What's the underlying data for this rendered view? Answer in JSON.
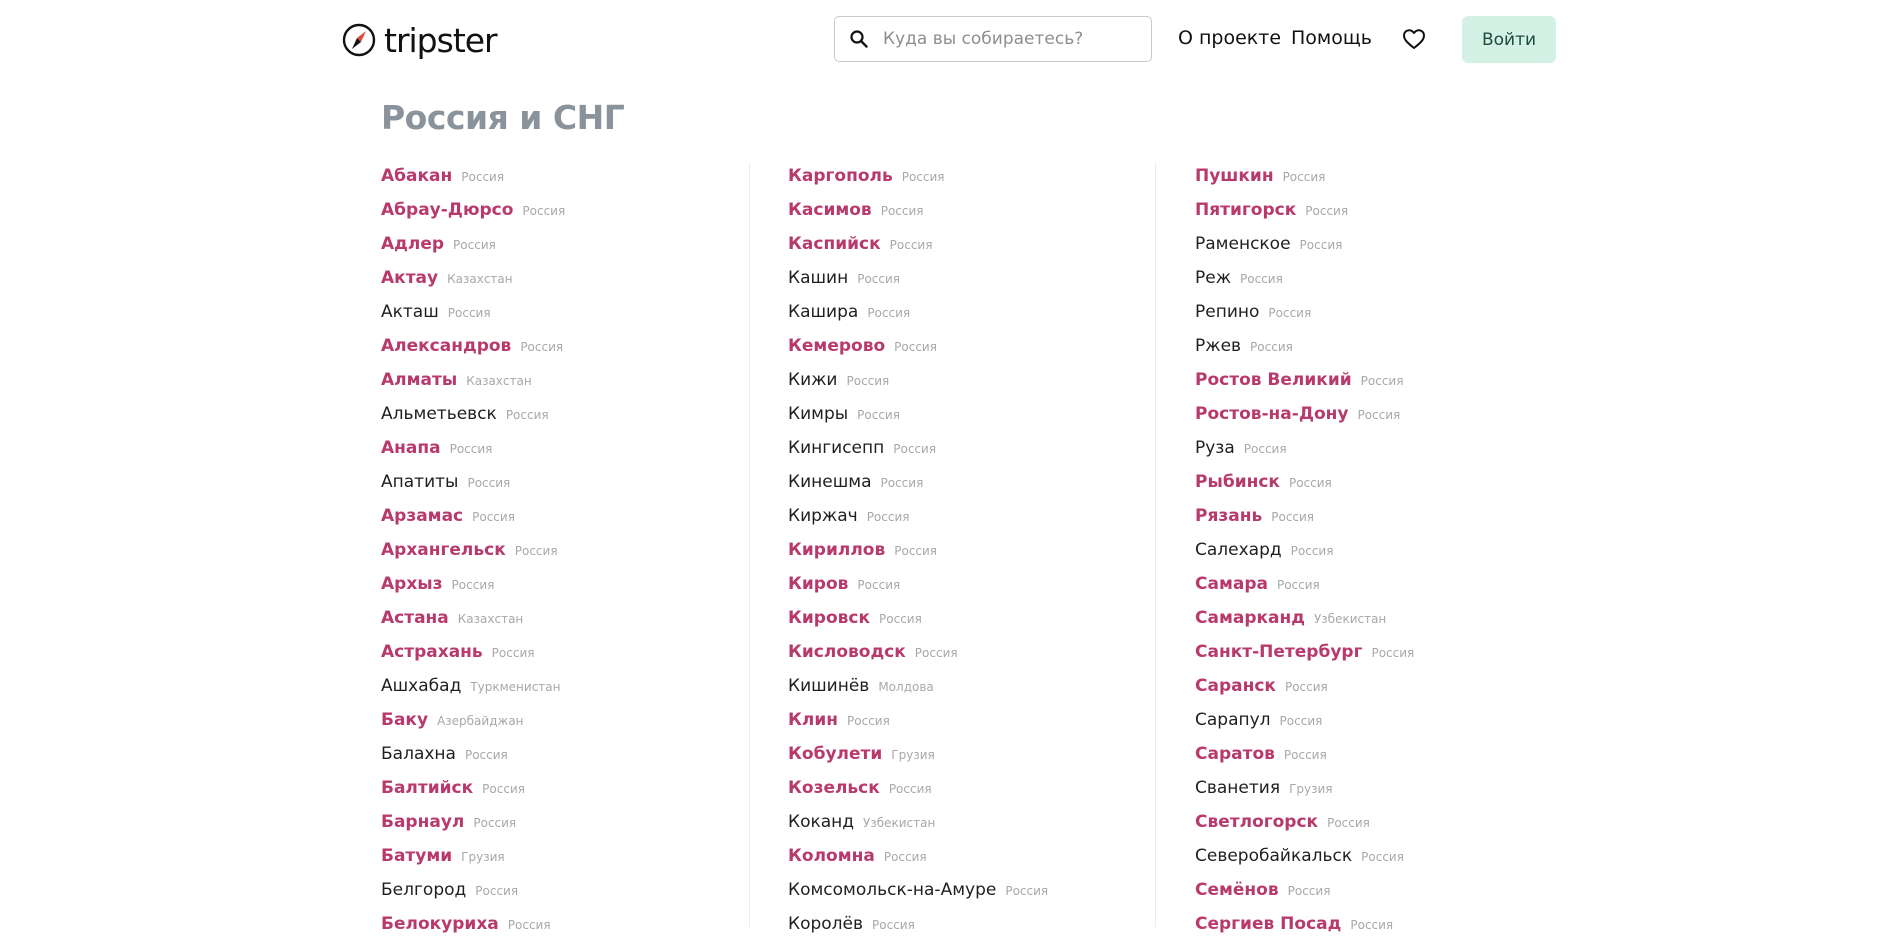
{
  "header": {
    "logo_text": "tripster",
    "search_placeholder": "Куда вы собираетесь?",
    "nav_about": "О проекте",
    "nav_help": "Помощь",
    "login_label": "Войти"
  },
  "page": {
    "title": "Россия и СНГ"
  },
  "colors": {
    "accent": "#b83a6d",
    "login_bg": "#d4f1e6",
    "title": "#8a939c"
  },
  "icons": [
    "compass-logo-icon",
    "search-icon",
    "heart-icon"
  ],
  "columns": [
    [
      {
        "name": "Абакан",
        "country": "Россия",
        "hl": true
      },
      {
        "name": "Абрау-Дюрсо",
        "country": "Россия",
        "hl": true
      },
      {
        "name": "Адлер",
        "country": "Россия",
        "hl": true
      },
      {
        "name": "Актау",
        "country": "Казахстан",
        "hl": true
      },
      {
        "name": "Акташ",
        "country": "Россия",
        "hl": false
      },
      {
        "name": "Александров",
        "country": "Россия",
        "hl": true
      },
      {
        "name": "Алматы",
        "country": "Казахстан",
        "hl": true
      },
      {
        "name": "Альметьевск",
        "country": "Россия",
        "hl": false
      },
      {
        "name": "Анапа",
        "country": "Россия",
        "hl": true
      },
      {
        "name": "Апатиты",
        "country": "Россия",
        "hl": false
      },
      {
        "name": "Арзамас",
        "country": "Россия",
        "hl": true
      },
      {
        "name": "Архангельск",
        "country": "Россия",
        "hl": true
      },
      {
        "name": "Архыз",
        "country": "Россия",
        "hl": true
      },
      {
        "name": "Астана",
        "country": "Казахстан",
        "hl": true
      },
      {
        "name": "Астрахань",
        "country": "Россия",
        "hl": true
      },
      {
        "name": "Ашхабад",
        "country": "Туркменистан",
        "hl": false
      },
      {
        "name": "Баку",
        "country": "Азербайджан",
        "hl": true
      },
      {
        "name": "Балахна",
        "country": "Россия",
        "hl": false
      },
      {
        "name": "Балтийск",
        "country": "Россия",
        "hl": true
      },
      {
        "name": "Барнаул",
        "country": "Россия",
        "hl": true
      },
      {
        "name": "Батуми",
        "country": "Грузия",
        "hl": true
      },
      {
        "name": "Белгород",
        "country": "Россия",
        "hl": false
      },
      {
        "name": "Белокуриха",
        "country": "Россия",
        "hl": true
      }
    ],
    [
      {
        "name": "Каргополь",
        "country": "Россия",
        "hl": true
      },
      {
        "name": "Касимов",
        "country": "Россия",
        "hl": true
      },
      {
        "name": "Каспийск",
        "country": "Россия",
        "hl": true
      },
      {
        "name": "Кашин",
        "country": "Россия",
        "hl": false
      },
      {
        "name": "Кашира",
        "country": "Россия",
        "hl": false
      },
      {
        "name": "Кемерово",
        "country": "Россия",
        "hl": true
      },
      {
        "name": "Кижи",
        "country": "Россия",
        "hl": false
      },
      {
        "name": "Кимры",
        "country": "Россия",
        "hl": false
      },
      {
        "name": "Кингисепп",
        "country": "Россия",
        "hl": false
      },
      {
        "name": "Кинешма",
        "country": "Россия",
        "hl": false
      },
      {
        "name": "Киржач",
        "country": "Россия",
        "hl": false
      },
      {
        "name": "Кириллов",
        "country": "Россия",
        "hl": true
      },
      {
        "name": "Киров",
        "country": "Россия",
        "hl": true
      },
      {
        "name": "Кировск",
        "country": "Россия",
        "hl": true
      },
      {
        "name": "Кисловодск",
        "country": "Россия",
        "hl": true
      },
      {
        "name": "Кишинёв",
        "country": "Молдова",
        "hl": false
      },
      {
        "name": "Клин",
        "country": "Россия",
        "hl": true
      },
      {
        "name": "Кобулети",
        "country": "Грузия",
        "hl": true
      },
      {
        "name": "Козельск",
        "country": "Россия",
        "hl": true
      },
      {
        "name": "Коканд",
        "country": "Узбекистан",
        "hl": false
      },
      {
        "name": "Коломна",
        "country": "Россия",
        "hl": true
      },
      {
        "name": "Комсомольск-на-Амуре",
        "country": "Россия",
        "hl": false
      },
      {
        "name": "Королёв",
        "country": "Россия",
        "hl": false
      }
    ],
    [
      {
        "name": "Пушкин",
        "country": "Россия",
        "hl": true
      },
      {
        "name": "Пятигорск",
        "country": "Россия",
        "hl": true
      },
      {
        "name": "Раменское",
        "country": "Россия",
        "hl": false
      },
      {
        "name": "Реж",
        "country": "Россия",
        "hl": false
      },
      {
        "name": "Репино",
        "country": "Россия",
        "hl": false
      },
      {
        "name": "Ржев",
        "country": "Россия",
        "hl": false
      },
      {
        "name": "Ростов Великий",
        "country": "Россия",
        "hl": true
      },
      {
        "name": "Ростов-на-Дону",
        "country": "Россия",
        "hl": true
      },
      {
        "name": "Руза",
        "country": "Россия",
        "hl": false
      },
      {
        "name": "Рыбинск",
        "country": "Россия",
        "hl": true
      },
      {
        "name": "Рязань",
        "country": "Россия",
        "hl": true
      },
      {
        "name": "Салехард",
        "country": "Россия",
        "hl": false
      },
      {
        "name": "Самара",
        "country": "Россия",
        "hl": true
      },
      {
        "name": "Самарканд",
        "country": "Узбекистан",
        "hl": true
      },
      {
        "name": "Санкт-Петербург",
        "country": "Россия",
        "hl": true
      },
      {
        "name": "Саранск",
        "country": "Россия",
        "hl": true
      },
      {
        "name": "Сарапул",
        "country": "Россия",
        "hl": false
      },
      {
        "name": "Саратов",
        "country": "Россия",
        "hl": true
      },
      {
        "name": "Сванетия",
        "country": "Грузия",
        "hl": false
      },
      {
        "name": "Светлогорск",
        "country": "Россия",
        "hl": true
      },
      {
        "name": "Северобайкальск",
        "country": "Россия",
        "hl": false
      },
      {
        "name": "Семёнов",
        "country": "Россия",
        "hl": true
      },
      {
        "name": "Сергиев Посад",
        "country": "Россия",
        "hl": true
      }
    ]
  ]
}
